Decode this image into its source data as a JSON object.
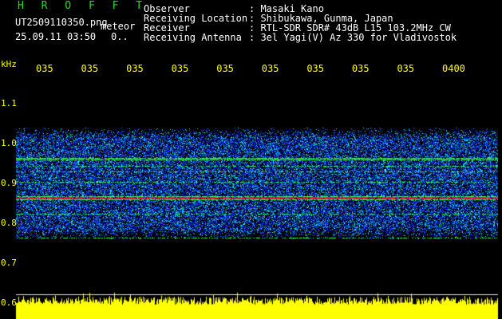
{
  "header": {
    "program": "H R O F F T",
    "file_name": "UT2509110350.png",
    "file_suffix": "meteor",
    "datetime": "25.09.11 03:50",
    "count": "0..",
    "info": [
      {
        "key": "Observer",
        "value": ": Masaki Kano"
      },
      {
        "key": "Receiving Location",
        "value": ": Shibukawa, Gunma, Japan"
      },
      {
        "key": "Receiver",
        "value": ": RTL-SDR SDR# 43dB L15 103.2MHz CW"
      },
      {
        "key": "Receiving Antenna",
        "value": ": 3el Yagi(V) Az 330 for Vladivostok"
      }
    ]
  },
  "chart_data": {
    "type": "heatmap",
    "ylabel": "kHz",
    "y_ticks": [
      "1.1",
      "1.0",
      "0.9",
      "0.8",
      "0.7",
      "0.6"
    ],
    "y_tick_values": [
      1.1,
      1.0,
      0.9,
      0.8,
      0.7,
      0.6
    ],
    "ylim": [
      0.6,
      1.1
    ],
    "x_ticks": [
      "035",
      "035",
      "035",
      "035",
      "035",
      "035",
      "035",
      "035",
      "035",
      "0400"
    ],
    "signal_band": [
      0.76,
      1.04
    ],
    "strong_lines": [
      0.865,
      0.963
    ],
    "medium_lines": [
      0.825,
      0.905,
      0.93,
      0.945
    ],
    "colors": {
      "background": "#000000",
      "noise": "#1030ff",
      "strong": "#ff1040",
      "medium": "#30ff60",
      "timing_trace": "#ffff00",
      "text": "#ffffff",
      "axis_text": "#ffff00",
      "title": "#1ee01e"
    }
  }
}
